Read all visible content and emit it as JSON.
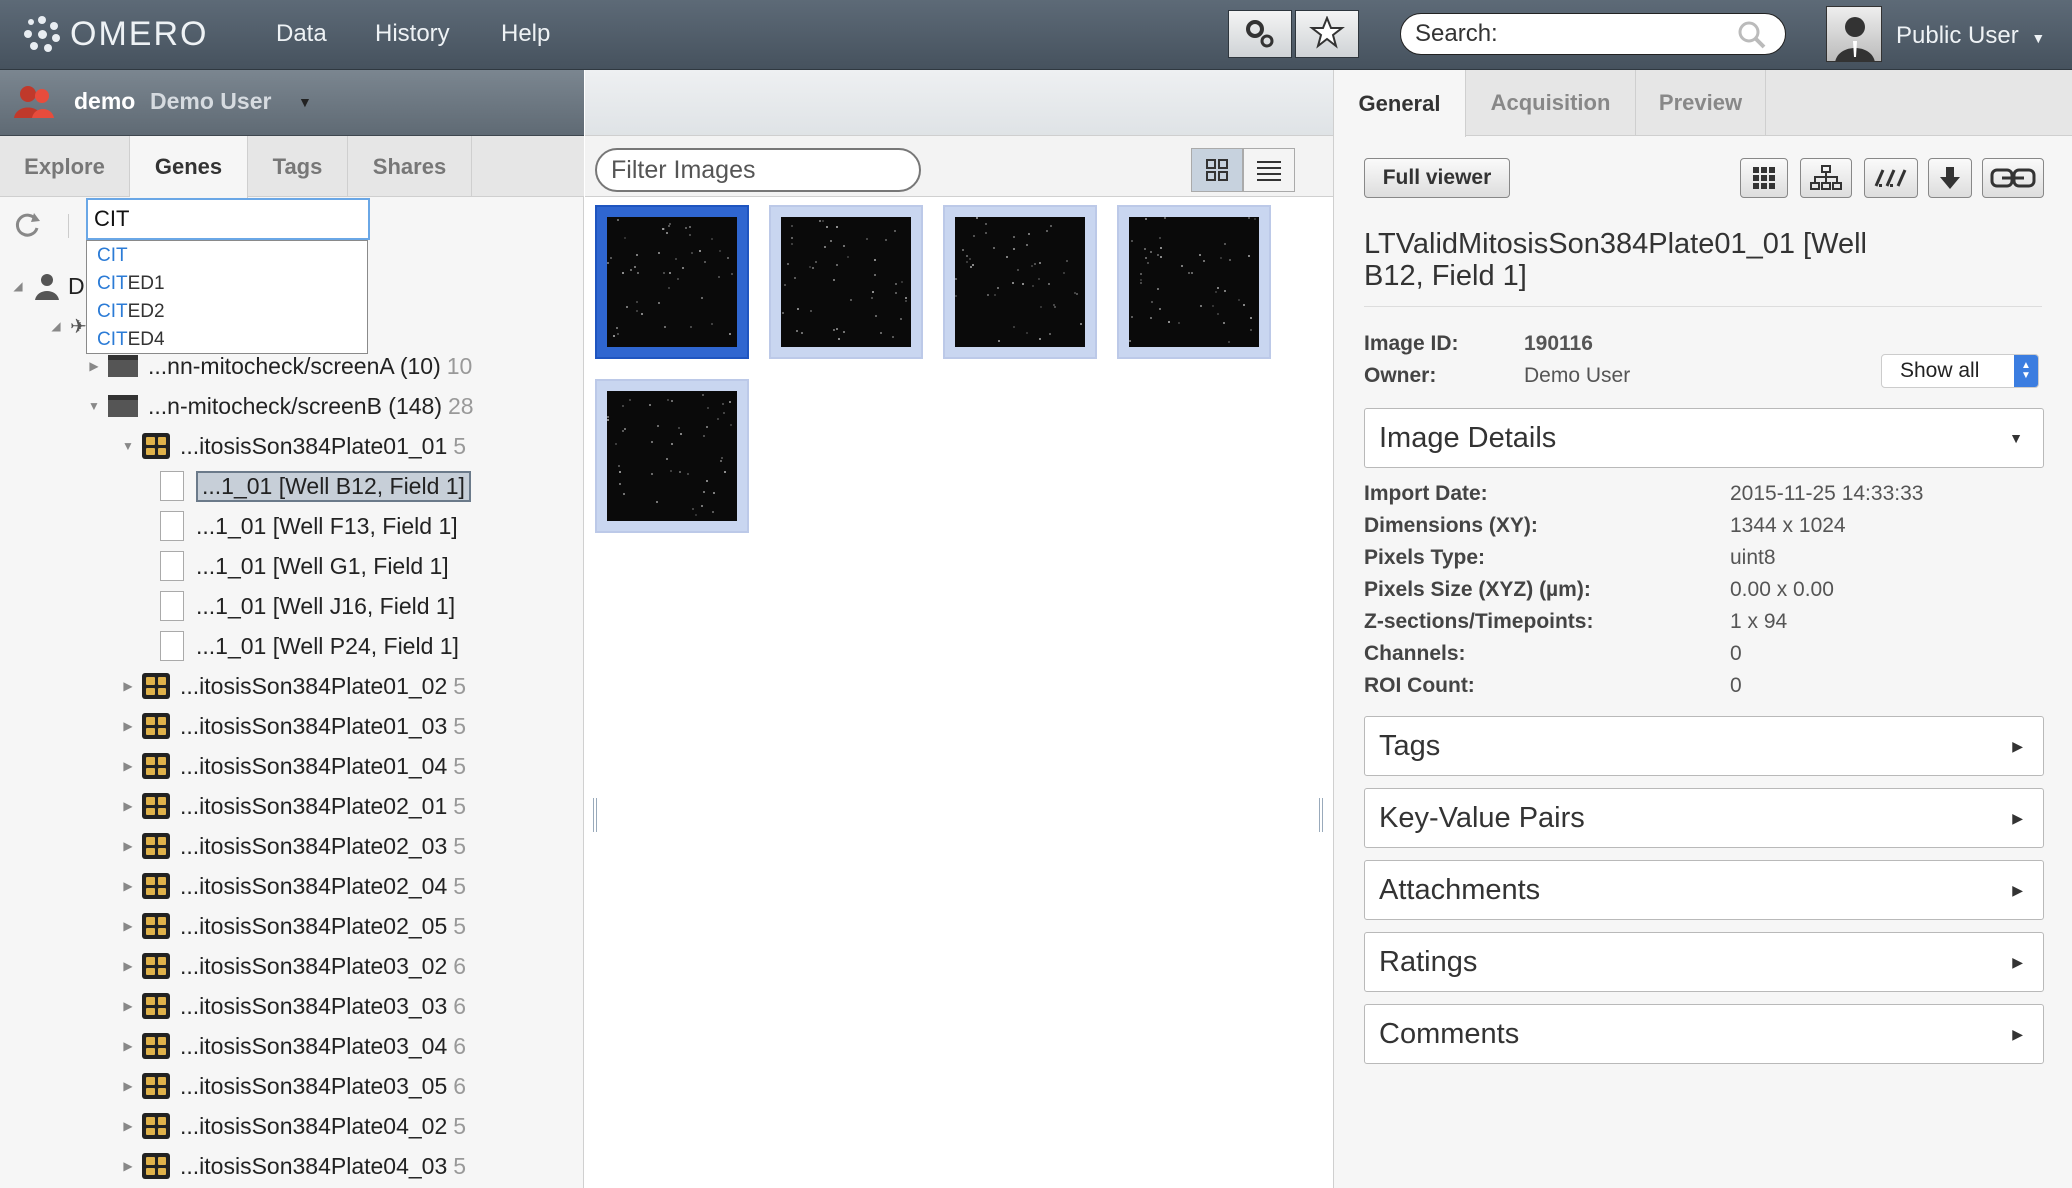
{
  "topbar": {
    "logo_text": "OMERO",
    "nav": [
      "Data",
      "History",
      "Help"
    ],
    "search_placeholder": "Search:",
    "user": "Public User"
  },
  "left": {
    "group_name": "demo",
    "user_name": "Demo User",
    "tabs": [
      "Explore",
      "Genes",
      "Tags",
      "Shares"
    ],
    "active_tab": "Genes",
    "gene_query": "CIT",
    "suggestions": [
      {
        "match": "CIT",
        "rest": ""
      },
      {
        "match": "CIT",
        "rest": "ED1"
      },
      {
        "match": "CIT",
        "rest": "ED2"
      },
      {
        "match": "CIT",
        "rest": "ED4"
      }
    ],
    "tree_root_partial": "D",
    "tree": [
      {
        "type": "screen",
        "label": "...nn-mitocheck/screenA (10)",
        "count": "10"
      },
      {
        "type": "screen",
        "label": "...n-mitocheck/screenB (148)",
        "count": "28"
      },
      {
        "type": "plate",
        "label": "...itosisSon384Plate01_01",
        "count": "5"
      },
      {
        "type": "image",
        "label": "...1_01 [Well B12, Field 1]",
        "count": ""
      },
      {
        "type": "image",
        "label": "...1_01 [Well F13, Field 1]",
        "count": ""
      },
      {
        "type": "image",
        "label": "...1_01 [Well G1, Field 1]",
        "count": ""
      },
      {
        "type": "image",
        "label": "...1_01 [Well J16, Field 1]",
        "count": ""
      },
      {
        "type": "image",
        "label": "...1_01 [Well P24, Field 1]",
        "count": ""
      },
      {
        "type": "plate",
        "label": "...itosisSon384Plate01_02",
        "count": "5"
      },
      {
        "type": "plate",
        "label": "...itosisSon384Plate01_03",
        "count": "5"
      },
      {
        "type": "plate",
        "label": "...itosisSon384Plate01_04",
        "count": "5"
      },
      {
        "type": "plate",
        "label": "...itosisSon384Plate02_01",
        "count": "5"
      },
      {
        "type": "plate",
        "label": "...itosisSon384Plate02_03",
        "count": "5"
      },
      {
        "type": "plate",
        "label": "...itosisSon384Plate02_04",
        "count": "5"
      },
      {
        "type": "plate",
        "label": "...itosisSon384Plate02_05",
        "count": "5"
      },
      {
        "type": "plate",
        "label": "...itosisSon384Plate03_02",
        "count": "6"
      },
      {
        "type": "plate",
        "label": "...itosisSon384Plate03_03",
        "count": "6"
      },
      {
        "type": "plate",
        "label": "...itosisSon384Plate03_04",
        "count": "6"
      },
      {
        "type": "plate",
        "label": "...itosisSon384Plate03_05",
        "count": "6"
      },
      {
        "type": "plate",
        "label": "...itosisSon384Plate04_02",
        "count": "5"
      },
      {
        "type": "plate",
        "label": "...itosisSon384Plate04_03",
        "count": "5"
      }
    ]
  },
  "center": {
    "filter_placeholder": "Filter Images",
    "thumbnail_count": 5
  },
  "right": {
    "tabs": [
      "General",
      "Acquisition",
      "Preview"
    ],
    "active_tab": "General",
    "full_viewer": "Full viewer",
    "title": "LTValidMitosisSon384Plate01_01 [Well B12, Field 1]",
    "image_id_label": "Image ID:",
    "image_id": "190116",
    "owner_label": "Owner:",
    "owner": "Demo User",
    "show_all": "Show all",
    "details_header": "Image Details",
    "details": [
      {
        "label": "Import Date:",
        "value": "2015-11-25 14:33:33"
      },
      {
        "label": "Dimensions (XY):",
        "value": "1344 x 1024"
      },
      {
        "label": "Pixels Type:",
        "value": "uint8"
      },
      {
        "label": "Pixels Size (XYZ) (µm):",
        "value": "0.00 x 0.00"
      },
      {
        "label": "Z-sections/Timepoints:",
        "value": "1 x 94"
      },
      {
        "label": "Channels:",
        "value": "0"
      },
      {
        "label": "ROI Count:",
        "value": "0"
      }
    ],
    "sections": [
      "Tags",
      "Key-Value Pairs",
      "Attachments",
      "Ratings",
      "Comments"
    ]
  },
  "colors": {
    "topbar": "#4f5b67",
    "accent_blue": "#2b7bd6",
    "selection_blue": "#2f66d0"
  }
}
